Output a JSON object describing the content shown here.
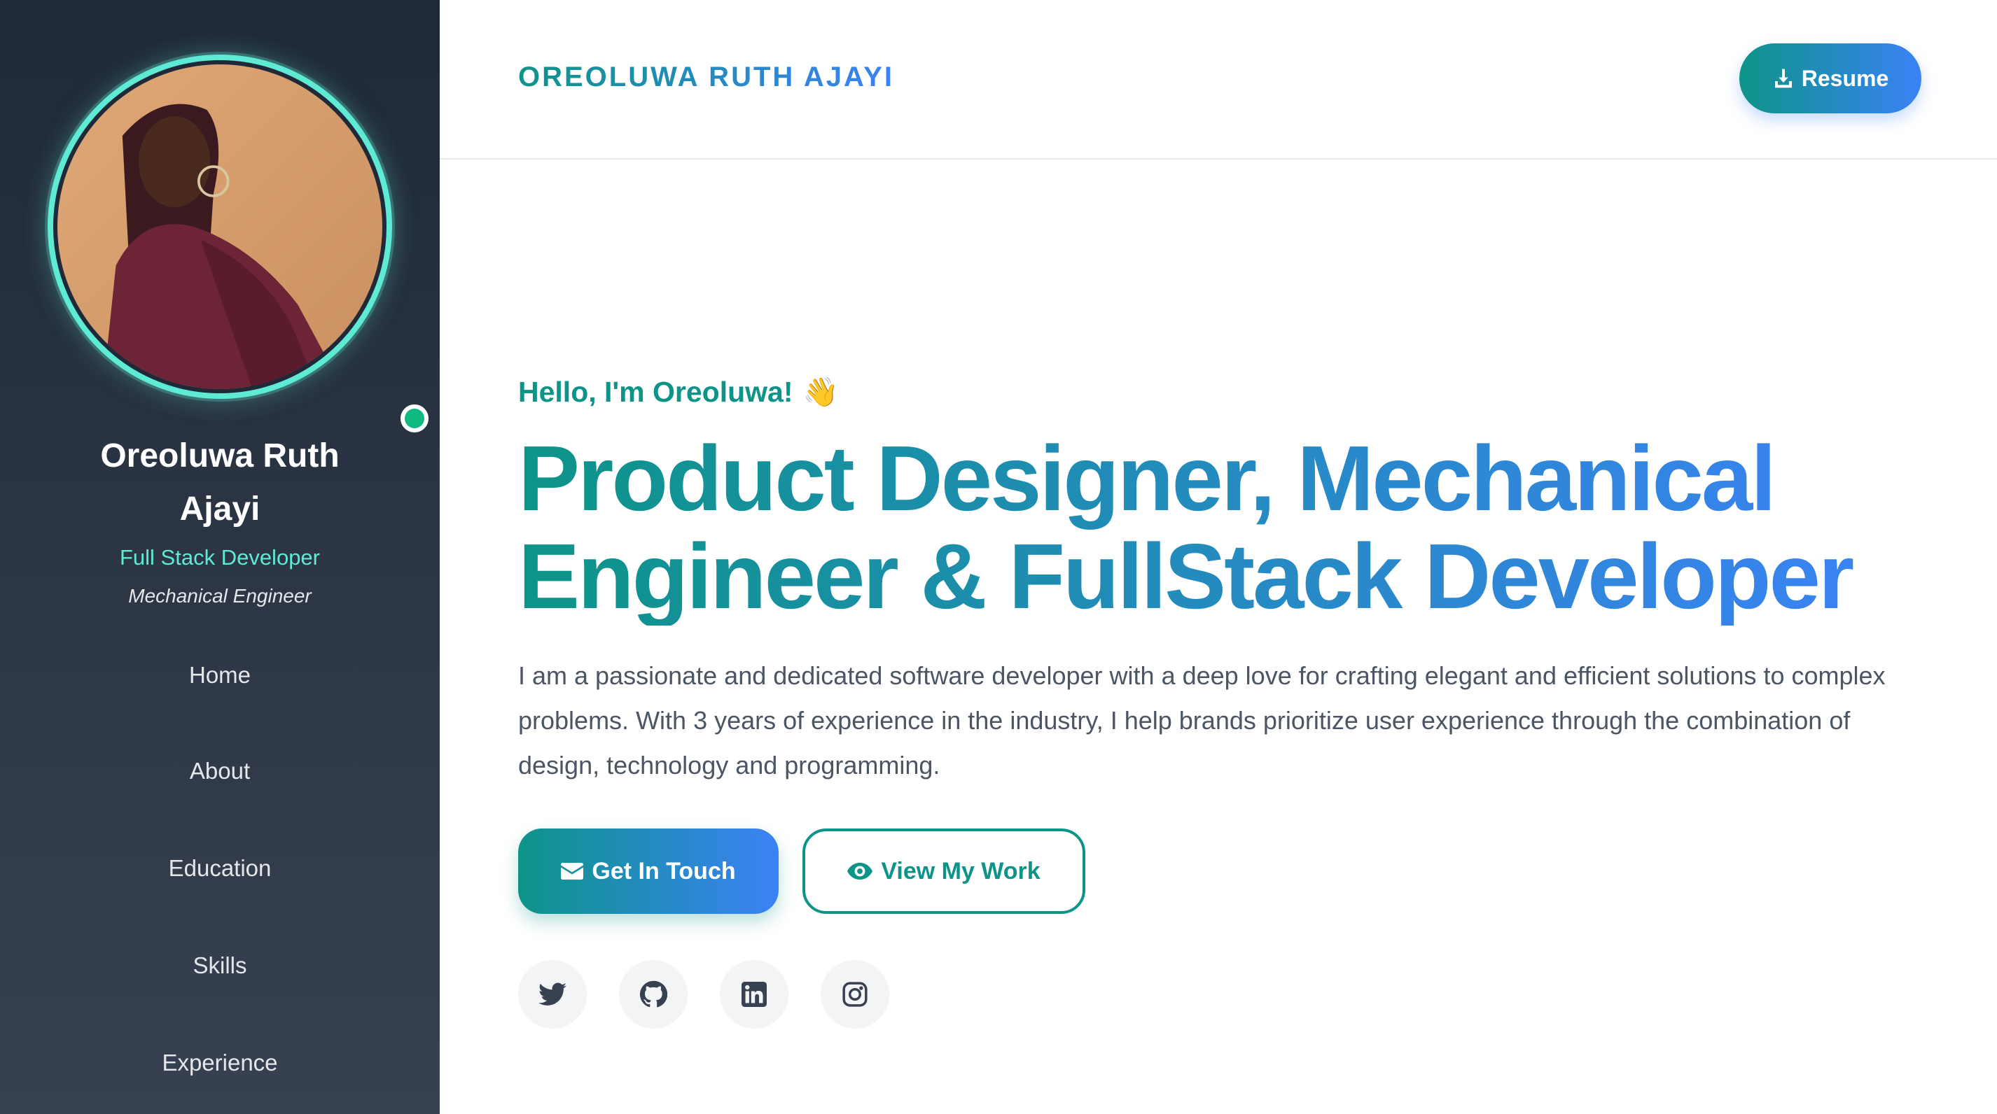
{
  "sidebar": {
    "name": "Oreoluwa Ruth Ajayi",
    "role": "Full Stack Developer",
    "subtitle": "Mechanical Engineer",
    "status": "online",
    "nav": [
      {
        "label": "Home"
      },
      {
        "label": "About"
      },
      {
        "label": "Education"
      },
      {
        "label": "Skills"
      },
      {
        "label": "Experience"
      }
    ]
  },
  "header": {
    "brand": "OREOLUWA RUTH AJAYI",
    "resume_label": "Resume",
    "resume_icon": "download-icon"
  },
  "hero": {
    "greeting": "Hello, I'm Oreoluwa!",
    "greeting_emoji": "👋",
    "headline": "Product Designer, Mechanical Engineer & FullStack Developer",
    "intro": "I am a passionate and dedicated software developer with a deep love for crafting elegant and efficient solutions to complex problems. With 3 years of experience in the industry, I help brands prioritize user experience through the combination of design, technology and programming.",
    "primary_cta": {
      "label": "Get In Touch",
      "icon": "envelope-icon"
    },
    "secondary_cta": {
      "label": "View My Work",
      "icon": "eye-icon"
    }
  },
  "socials": [
    {
      "name": "twitter-icon"
    },
    {
      "name": "github-icon"
    },
    {
      "name": "linkedin-icon"
    },
    {
      "name": "instagram-icon"
    }
  ],
  "colors": {
    "accent_start": "#0d9488",
    "accent_end": "#3b82f6",
    "sidebar_top": "#1f2937",
    "sidebar_bottom": "#374151",
    "ring": "#5eead4",
    "status_dot": "#10b981"
  }
}
